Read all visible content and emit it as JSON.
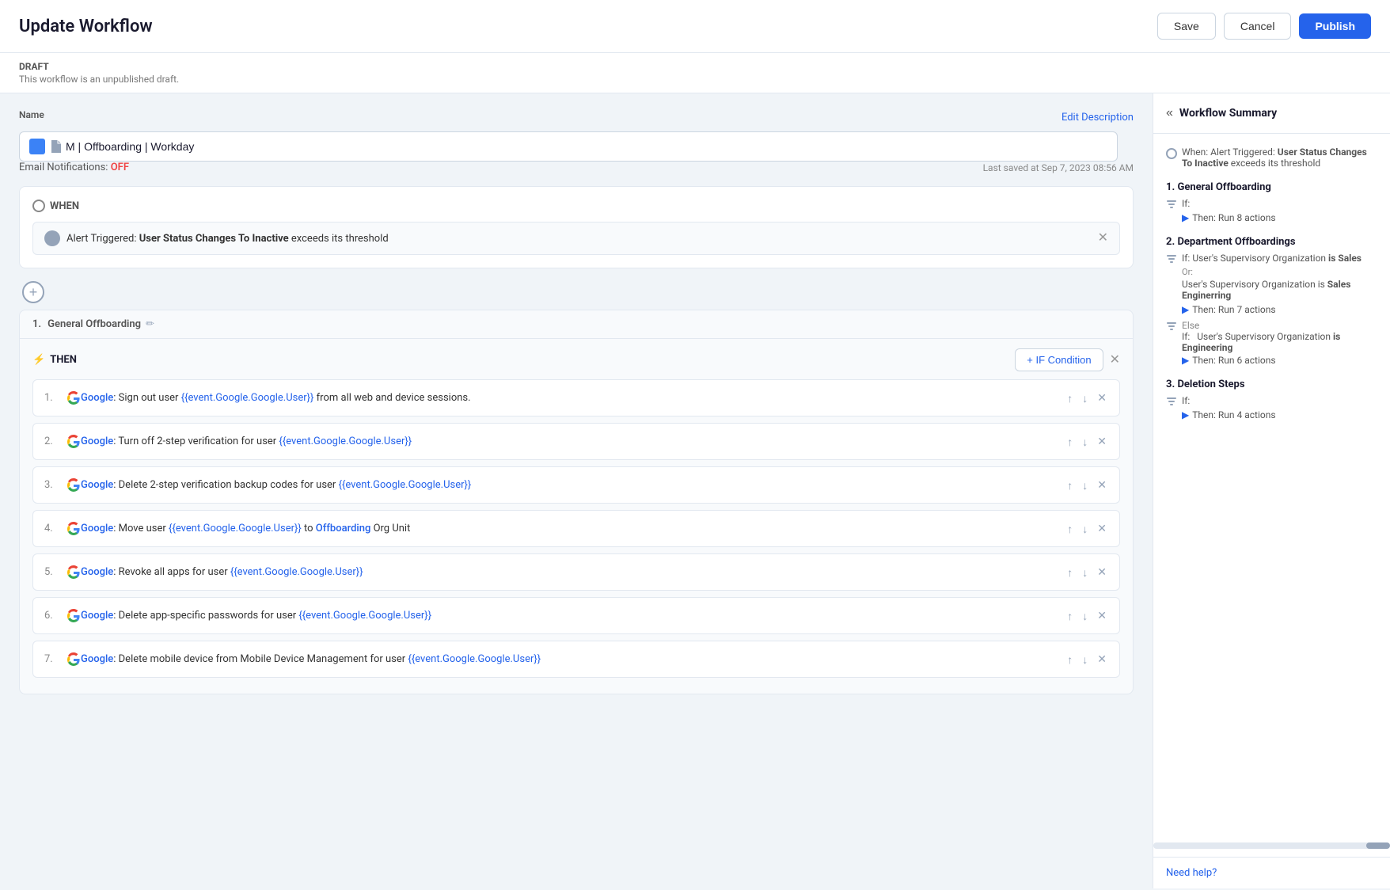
{
  "page": {
    "title": "Update Workflow"
  },
  "topbar": {
    "save_label": "Save",
    "cancel_label": "Cancel",
    "publish_label": "Publish"
  },
  "draft": {
    "label": "DRAFT",
    "description": "This workflow is an unpublished draft."
  },
  "name_field": {
    "label": "Name",
    "value": "M | Offboarding | Workday",
    "edit_description": "Edit Description"
  },
  "email_notifications": {
    "label": "Email Notifications:",
    "status": "OFF",
    "last_saved": "Last saved at Sep 7, 2023 08:56 AM"
  },
  "when_section": {
    "label": "WHEN",
    "trigger": "Alert Triggered: User Status Changes To Inactive exceeds its threshold"
  },
  "block": {
    "number": "1.",
    "name": "General Offboarding"
  },
  "then_section": {
    "label": "THEN",
    "add_condition": "+ IF Condition"
  },
  "actions": [
    {
      "number": "1.",
      "text": ": Sign out user ",
      "link": "Google",
      "var": "{{event.Google.Google.User}}",
      "suffix": " from all web and device sessions."
    },
    {
      "number": "2.",
      "text": ": Turn off 2-step verification for user ",
      "link": "Google",
      "var": "{{event.Google.Google.User}}"
    },
    {
      "number": "3.",
      "text": ": Delete 2-step verification backup codes for user ",
      "link": "Google",
      "var": "{{event.Google.Google.User}}"
    },
    {
      "number": "4.",
      "text": ": Move user ",
      "link": "Google",
      "var": "{{event.Google.Google.User}}",
      "suffix_link": "Offboarding",
      "suffix": " Org Unit",
      "to": " to "
    },
    {
      "number": "5.",
      "text": ": Revoke all apps for user ",
      "link": "Google",
      "var": "{{event.Google.Google.User}}"
    },
    {
      "number": "6.",
      "text": ": Delete app-specific passwords for user ",
      "link": "Google",
      "var": "{{event.Google.Google.User}}"
    },
    {
      "number": "7.",
      "text": ": Delete mobile device from Mobile Device Management for user ",
      "link": "Google",
      "var": "{{event.Google.Google.User}}"
    }
  ],
  "sidebar": {
    "title": "Workflow Summary",
    "trigger_text": "When: Alert Triggered: ",
    "trigger_bold": "User Status Changes To Inactive",
    "trigger_suffix": " exceeds its threshold",
    "sections": [
      {
        "number": "1.",
        "name": "General Offboarding",
        "if_label": "If:",
        "then_label": "Then: Run 8 actions"
      },
      {
        "number": "2.",
        "name": "Department Offboardings",
        "if_label": "If: User's Supervisory Organization",
        "is_label": "is Sales",
        "or_label": "Or:",
        "or_text": "User's Supervisory Organization is Sales Enginerring",
        "then_label": "Then: Run 7 actions",
        "else_label": "Else",
        "else_if_label": "If:",
        "else_if_text": "User's Supervisory Organization is Engineering",
        "then2_label": "Then: Run 6 actions"
      },
      {
        "number": "3.",
        "name": "Deletion Steps",
        "if_label": "If:",
        "then_label": "Then: Run 4 actions"
      }
    ],
    "need_help": "Need help?"
  }
}
